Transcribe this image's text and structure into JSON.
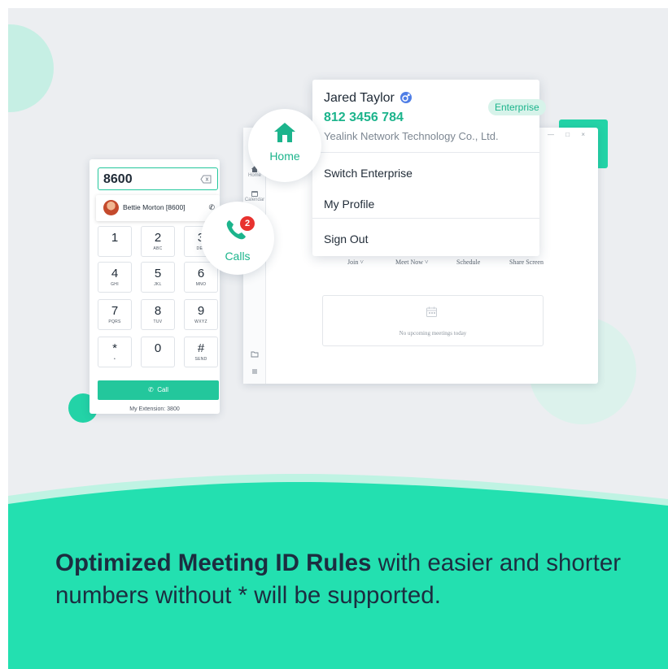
{
  "colors": {
    "accent": "#23d3a7",
    "accent_text": "#1cb48c",
    "background": "#eceef1",
    "band": "#23e0b0",
    "badge": "#e8322f",
    "caption_text": "#1c2d40"
  },
  "app_window": {
    "sidebar": [
      {
        "label": "Home",
        "icon": "home-icon"
      },
      {
        "label": "Calendar",
        "icon": "calendar-icon"
      },
      {
        "label": "",
        "icon": "folder-icon"
      },
      {
        "label": "",
        "icon": "menu-icon"
      }
    ],
    "window_controls": "— □ ×",
    "actions": [
      "Join ˅",
      "Meet Now ˅",
      "Schedule",
      "Share Screen"
    ],
    "empty_state": "No upcoming meetings today"
  },
  "profile_menu": {
    "name": "Jared Taylor",
    "phone": "812 3456 784",
    "company": "Yealink Network Technology Co., Ltd.",
    "badge": "Enterprise",
    "items": [
      "Switch Enterprise",
      "My Profile",
      "Sign Out"
    ]
  },
  "dialer": {
    "input_value": "8600",
    "suggestion": {
      "name": "Bettie Morton [8600]"
    },
    "keys": [
      {
        "digit": "1",
        "letters": ""
      },
      {
        "digit": "2",
        "letters": "ABC"
      },
      {
        "digit": "3",
        "letters": "DEF"
      },
      {
        "digit": "4",
        "letters": "GHI"
      },
      {
        "digit": "5",
        "letters": "JKL"
      },
      {
        "digit": "6",
        "letters": "MNO"
      },
      {
        "digit": "7",
        "letters": "PQRS"
      },
      {
        "digit": "8",
        "letters": "TUV"
      },
      {
        "digit": "9",
        "letters": "WXYZ"
      },
      {
        "digit": "*",
        "letters": "•"
      },
      {
        "digit": "0",
        "letters": ""
      },
      {
        "digit": "#",
        "letters": "SEND"
      }
    ],
    "call_label": "Call",
    "extension": "My Extension: 3800"
  },
  "bubbles": {
    "home_label": "Home",
    "calls_label": "Calls",
    "calls_badge": "2"
  },
  "caption": {
    "bold": "Optimized Meeting ID Rules",
    "rest": " with easier and shorter numbers without * will be supported."
  }
}
